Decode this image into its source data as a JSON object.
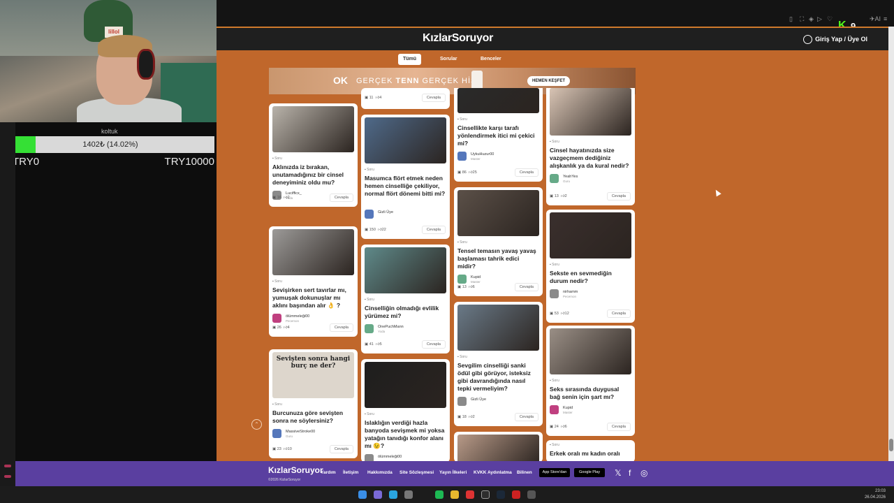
{
  "overlay": {
    "goal_label": "koltuk",
    "goal_text": "1402₺ (14.02%)",
    "goal_progress": 0.1402,
    "goal_min": "TRY0",
    "goal_max": "TRY10000",
    "webcam_sticker": "lillol"
  },
  "browser": {
    "kick_logo": "K",
    "kick_count": "9"
  },
  "header": {
    "logo": "KızlarSoruyor",
    "login": "Giriş Yap / Üye Ol"
  },
  "tabs": [
    "Tümü",
    "Sorular",
    "Benceler"
  ],
  "banner": {
    "brand": "OK",
    "slogan_1": "GERÇEK",
    "slogan_2": "TENN",
    "slogan_3": "GERÇEK HİS",
    "cta": "HEMEN KEŞFET"
  },
  "answer_label": "Cevapla",
  "columns": [
    [
      {
        "tag": "Soru",
        "title": "Aklınızda iz bırakan, unutamadığınız bir cinsel deneyiminiz oldu mu?",
        "author": "Lucifficx_",
        "rank": "Yoda",
        "views": "16",
        "likes": "2",
        "color": "#b9b3aa"
      },
      {
        "tag": "Soru",
        "title": "Sevişirken sert tavırlar mı, yumuşak dokunuşlar mı aklını başından alır 👌 ?",
        "author": "ölümmeleği00",
        "rank": "Pecemon",
        "views": "26",
        "likes": "4",
        "color": "#9c9a98"
      },
      {
        "tag": "Soru",
        "title": "Burcunuza göre sevişten sonra ne söylersiniz?",
        "author": "MassiveStroke00",
        "rank": "Guru",
        "views": "23",
        "likes": "10",
        "color": "#ddd6cc",
        "image_text": "Sevişten sonra hangi burç ne der?"
      }
    ],
    [
      {
        "tag": "",
        "title": "",
        "author": "",
        "rank": "",
        "views": "11",
        "likes": "4",
        "color": ""
      },
      {
        "tag": "Soru",
        "title": "Masumca flört etmek neden hemen cinselliğe çekiliyor, normal flört dönemi bitti mi?",
        "author": "Gizli Üye",
        "rank": "",
        "views": "150",
        "likes": "22",
        "color": "#4f6a8a"
      },
      {
        "tag": "Soru",
        "title": "Cinselliğin olmadığı evlilik yürümez mi?",
        "author": "OnePuchMann",
        "rank": "Yoda",
        "views": "41",
        "likes": "5",
        "color": "#5f8a8a"
      },
      {
        "tag": "Soru",
        "title": "Islaklığın verdiği hazla banyoda sevişmek mi yoksa yatağın tanıdığı konfor alanı mı 😉?",
        "author": "ölümmeleği00",
        "rank": "",
        "views": "",
        "likes": "",
        "color": "#1e1e1e"
      }
    ],
    [
      {
        "tag": "Soru",
        "title": "Cinsellikte karşı tarafı yönlendirmek itici mi çekici mi?",
        "author": "UykuHuzur00",
        "rank": "Master",
        "views": "86",
        "likes": "25",
        "color": "#2a2a2a"
      },
      {
        "tag": "Soru",
        "title": "Tensel temasın yavaş yavaş başlaması tahrik edici midir?",
        "author": "Kupid",
        "rank": "Master",
        "views": "13",
        "likes": "6",
        "color": "#5b5048"
      },
      {
        "tag": "Soru",
        "title": "Sevgilim cinselliği sanki ödül gibi görüyor, isteksiz gibi davrandığında nasıl tepki vermeliyim?",
        "author": "Gizli Üye",
        "rank": "",
        "views": "18",
        "likes": "2",
        "color": "#6a7a88"
      },
      {
        "tag": "",
        "title": "",
        "author": "",
        "rank": "",
        "views": "",
        "likes": "",
        "color": "#b89a88"
      }
    ],
    [
      {
        "tag": "Soru",
        "title": "Cinsel hayatınızda size vazgeçmem dediğiniz alışkanlık ya da kural nedir?",
        "author": "YeahYes",
        "rank": "Guru",
        "views": "13",
        "likes": "2",
        "color": "#d8c4b4"
      },
      {
        "tag": "Soru",
        "title": "Sekste en sevmediğin durum nedir?",
        "author": "nirhamm",
        "rank": "Pecemon",
        "views": "53",
        "likes": "12",
        "color": "#3a2f2d"
      },
      {
        "tag": "Soru",
        "title": "Seks sırasında duygusal bağ senin için şart mı?",
        "author": "Kupid",
        "rank": "Master",
        "views": "24",
        "likes": "6",
        "color": "#9a8f86"
      },
      {
        "tag": "Soru",
        "title": "Erkek oralı mı kadın oralı",
        "author": "",
        "rank": "",
        "views": "",
        "likes": "",
        "color": ""
      }
    ]
  ],
  "footer": {
    "logo": "KızlarSoruyor",
    "copyright": "©2026 KizlarSoruyor",
    "links": [
      "Yardım",
      "İletişim",
      "Hakkımızda",
      "Site Sözleşmesi",
      "Yayın İlkeleri",
      "KVKK Aydınlatma",
      "Bilinen"
    ],
    "app_store": "App Store'dan",
    "play_store": "Google Play"
  },
  "clock": {
    "time": "23:03",
    "date": "26.04.2026"
  }
}
